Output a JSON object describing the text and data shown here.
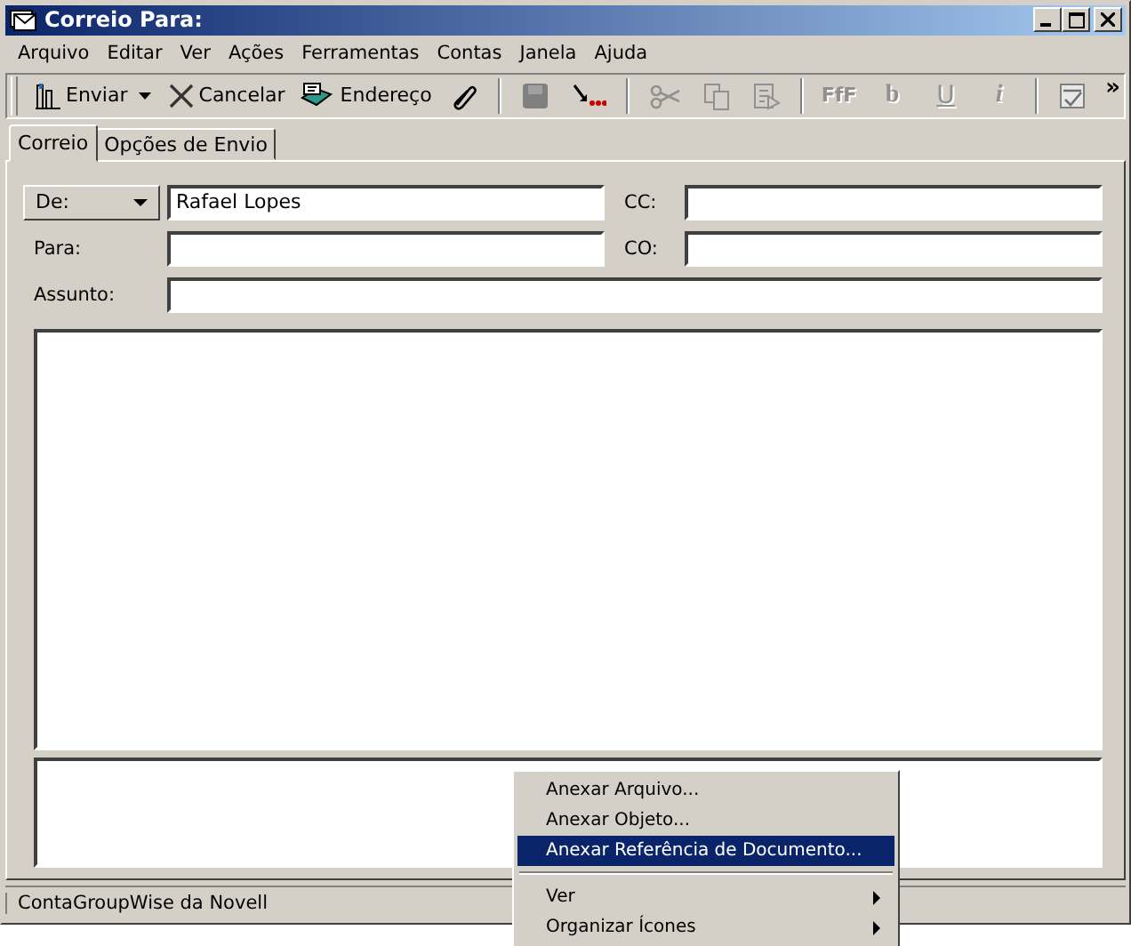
{
  "window": {
    "title": "Correio Para:"
  },
  "menu_bar": [
    "Arquivo",
    "Editar",
    "Ver",
    "Ações",
    "Ferramentas",
    "Contas",
    "Janela",
    "Ajuda"
  ],
  "toolbar": {
    "send": {
      "label": "Enviar"
    },
    "cancel": {
      "label": "Cancelar"
    },
    "address": {
      "label": "Endereço"
    },
    "save_disabled": true,
    "cut_disabled": true,
    "copy_disabled": true,
    "paste_disabled": true,
    "format_buttons": [
      {
        "label": "FfF",
        "disabled": true
      },
      {
        "label": "b",
        "disabled": true
      },
      {
        "label": "U",
        "disabled": true
      },
      {
        "label": "i",
        "disabled": true
      }
    ],
    "more": "»"
  },
  "tabs": [
    {
      "label": "Correio",
      "selected": true
    },
    {
      "label": "Opções de Envio",
      "selected": false
    }
  ],
  "form": {
    "from_button": "De:",
    "from_value": "Rafael Lopes",
    "cc_label": "CC:",
    "to_label": "Para:",
    "bcc_label": "CO:",
    "subject_label": "Assunto:"
  },
  "context_menu": [
    {
      "kind": "item",
      "label": "Anexar Arquivo...",
      "selected": false
    },
    {
      "kind": "item",
      "label": "Anexar Objeto...",
      "selected": false
    },
    {
      "kind": "item",
      "label": "Anexar Referência de Documento...",
      "selected": true
    },
    {
      "kind": "separator"
    },
    {
      "kind": "submenu",
      "label": "Ver",
      "selected": false
    },
    {
      "kind": "submenu",
      "label": "Organizar Ícones",
      "selected": false
    }
  ],
  "status_bar": "ContaGroupWise da Novell"
}
